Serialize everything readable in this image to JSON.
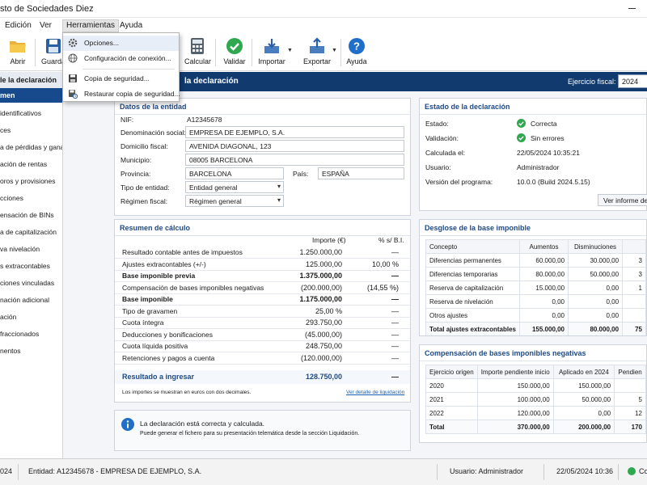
{
  "window": {
    "title": "sto de Sociedades Diez"
  },
  "menu": {
    "items": [
      "Edición",
      "Ver",
      "Herramientas",
      "Ayuda"
    ]
  },
  "dropdown": {
    "items": [
      {
        "label": "Opciones...",
        "icon": "gear-icon"
      },
      {
        "label": "Configuración de conexión...",
        "icon": "globe-icon"
      },
      {
        "label": "Copia de seguridad...",
        "icon": "save-icon"
      },
      {
        "label": "Restaurar copia de seguridad...",
        "icon": "restore-icon"
      }
    ]
  },
  "toolbar": {
    "abrir": "Abrir",
    "guardar": "Guarda",
    "calcular": "Calcular",
    "validar": "Validar",
    "importar": "Importar",
    "exportar": "Exportar",
    "ayuda": "Ayuda"
  },
  "sidebar": {
    "header": "le la declaración",
    "selected": "men",
    "items": [
      "identificativos",
      "ces",
      "a de pérdidas y ganancias",
      "ación de rentas",
      "oros y provisiones",
      "cciones",
      "ensación de BINs",
      "a de capitalización",
      "va nivelación",
      "s extracontables",
      "ciones vinculadas",
      "nación adicional",
      "ación",
      "fraccionados",
      "nentos"
    ]
  },
  "band": {
    "title": "la declaración",
    "fiscal_label": "Ejercicio fiscal:",
    "fiscal_value": "2024"
  },
  "entity": {
    "title": "Datos de la entidad",
    "nif_label": "NIF:",
    "nif": "A12345678",
    "name_label": "Denominación social:",
    "name": "EMPRESA DE EJEMPLO, S.A.",
    "address_label": "Domicilio fiscal:",
    "address": "AVENIDA DIAGONAL, 123",
    "city_label": "Municipio:",
    "city": "08005 BARCELONA",
    "province_label": "Provincia:",
    "province": "BARCELONA",
    "country_label": "País:",
    "country": "ESPAÑA",
    "type_label": "Tipo de entidad:",
    "type": "Entidad general",
    "regime_label": "Régimen fiscal:",
    "regime": "Régimen general"
  },
  "status": {
    "title": "Estado de la declaración",
    "estado_label": "Estado:",
    "estado": "Correcta",
    "validacion_label": "Validación:",
    "validacion": "Sin errores",
    "calculada_label": "Calculada el:",
    "calculada": "22/05/2024 10:35:21",
    "usuario_label": "Usuario:",
    "usuario": "Administrador",
    "version_label": "Versión del programa:",
    "version": "10.0.0 (Build 2024.5.15)",
    "report_button": "Ver informe de va"
  },
  "summary": {
    "title": "Resumen de cálculo",
    "col_importe": "Importe (€)",
    "col_pct": "% s/ B.I.",
    "rows": [
      {
        "label": "Resultado contable antes de impuestos",
        "value": "1.250.000,00",
        "pct": "—",
        "bold": false
      },
      {
        "label": "Ajustes extracontables (+/-)",
        "value": "125.000,00",
        "pct": "10,00 %",
        "bold": false
      },
      {
        "label": "Base imponible previa",
        "value": "1.375.000,00",
        "pct": "—",
        "bold": true
      },
      {
        "label": "Compensación de bases imponibles negativas",
        "value": "(200.000,00)",
        "pct": "(14,55 %)",
        "bold": false
      },
      {
        "label": "Base imponible",
        "value": "1.175.000,00",
        "pct": "—",
        "bold": true
      },
      {
        "label": "Tipo de gravamen",
        "value": "25,00 %",
        "pct": "—",
        "bold": false
      },
      {
        "label": "Cuota íntegra",
        "value": "293.750,00",
        "pct": "—",
        "bold": false
      },
      {
        "label": "Deducciones y bonificaciones",
        "value": "(45.000,00)",
        "pct": "—",
        "bold": false
      },
      {
        "label": "Cuota líquida positiva",
        "value": "248.750,00",
        "pct": "—",
        "bold": false
      },
      {
        "label": "Retenciones y pagos a cuenta",
        "value": "(120.000,00)",
        "pct": "—",
        "bold": false
      }
    ],
    "result_label": "Resultado a ingresar",
    "result_value": "128.750,00",
    "result_pct": "—",
    "note": "Los importes se muestran en euros con dos decimales.",
    "link": "Ver detalle de liquidación"
  },
  "breakdown": {
    "title": "Desglose de la base imponible",
    "headers": [
      "Concepto",
      "Aumentos",
      "Disminuciones",
      ""
    ],
    "rows": [
      [
        "Diferencias permanentes",
        "60.000,00",
        "30.000,00",
        "3"
      ],
      [
        "Diferencias temporarias",
        "80.000,00",
        "50.000,00",
        "3"
      ],
      [
        "Reserva de capitalización",
        "15.000,00",
        "0,00",
        "1"
      ],
      [
        "Reserva de nivelación",
        "0,00",
        "0,00",
        ""
      ],
      [
        "Otros ajustes",
        "0,00",
        "0,00",
        ""
      ]
    ],
    "total": [
      "Total ajustes extracontables",
      "155.000,00",
      "80.000,00",
      "75"
    ]
  },
  "bins": {
    "title": "Compensación de bases imponibles negativas",
    "headers": [
      "Ejercicio origen",
      "Importe pendiente inicio",
      "Aplicado en 2024",
      "Pendien"
    ],
    "rows": [
      [
        "2020",
        "150.000,00",
        "150.000,00",
        ""
      ],
      [
        "2021",
        "100.000,00",
        "50.000,00",
        "5"
      ],
      [
        "2022",
        "120.000,00",
        "0,00",
        "12"
      ]
    ],
    "total": [
      "Total",
      "370.000,00",
      "200.000,00",
      "170"
    ]
  },
  "info": {
    "line1": "La declaración está correcta y calculada.",
    "line2": "Puede generar el fichero para su presentación telemática desde la sección Liquidación."
  },
  "statusbar": {
    "year": "024",
    "entity": "Entidad:  A12345678 - EMPRESA DE EJEMPLO, S.A.",
    "user": "Usuario: Administrador",
    "datetime": "22/05/2024 10:36",
    "conn": "Co"
  },
  "colors": {
    "accent": "#113a6e",
    "selected": "#174a8c",
    "ok_green": "#2fa84f",
    "link": "#1a5fb4"
  }
}
